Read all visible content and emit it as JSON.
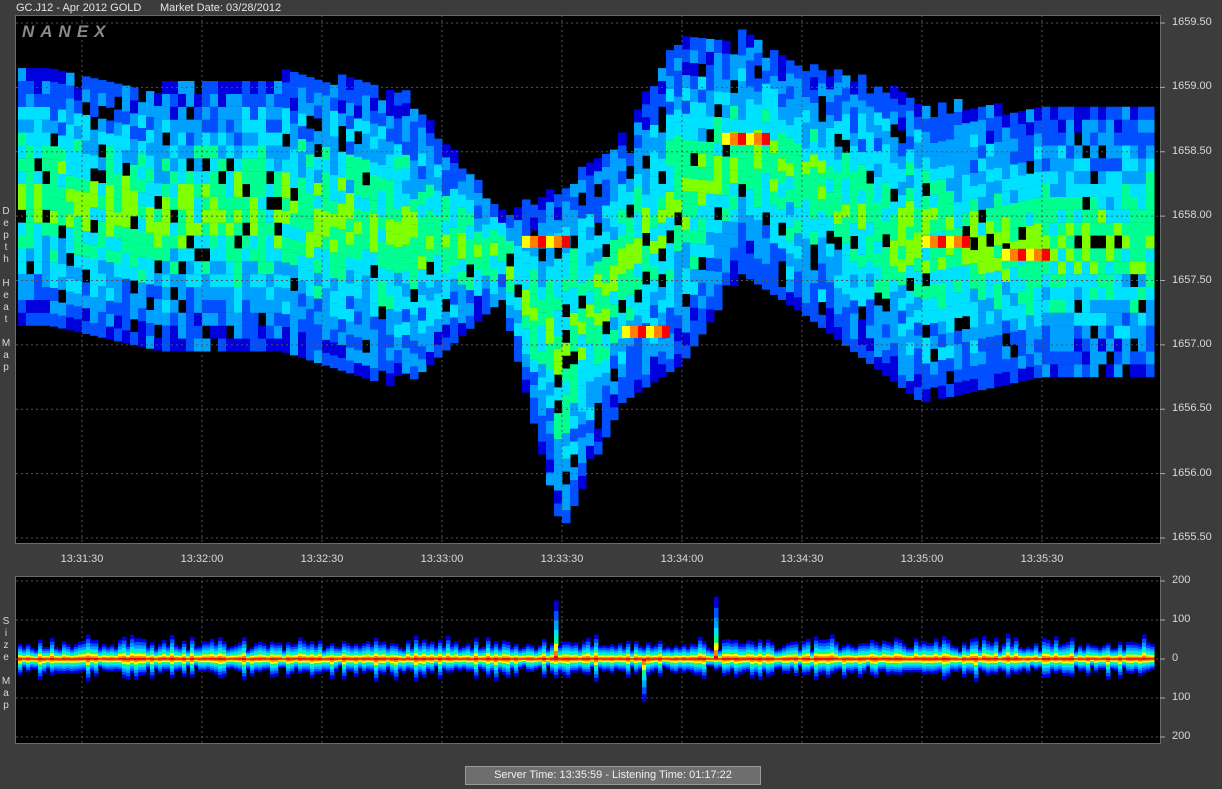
{
  "header": {
    "symbol": "GC.J12 - Apr 2012 GOLD",
    "market_date": "Market Date: 03/28/2012"
  },
  "logo": "NANEX",
  "status": {
    "text": "Server Time: 13:35:59  -  Listening Time: 01:17:22"
  },
  "side_labels": {
    "heat": [
      "D",
      "e",
      "p",
      "t",
      "h",
      " ",
      "H",
      "e",
      "a",
      "t",
      " ",
      "M",
      "a",
      "p"
    ],
    "size": [
      "S",
      "i",
      "z",
      "e",
      " ",
      "M",
      "a",
      "p"
    ]
  },
  "chart_data": [
    {
      "type": "heatmap",
      "title": "Depth Heat Map",
      "x_ticks": [
        "13:31:30",
        "13:32:00",
        "13:32:30",
        "13:33:00",
        "13:33:30",
        "13:34:00",
        "13:34:30",
        "13:35:00",
        "13:35:30"
      ],
      "y_ticks": [
        "1659.50",
        "1659.00",
        "1658.50",
        "1658.00",
        "1657.50",
        "1657.00",
        "1656.50",
        "1656.00",
        "1655.50"
      ],
      "ylim": [
        1655.5,
        1659.5
      ],
      "price_path": [
        {
          "t": "13:31:22",
          "low": 1657.2,
          "high": 1659.1
        },
        {
          "t": "13:31:50",
          "low": 1657.0,
          "high": 1659.0
        },
        {
          "t": "13:32:20",
          "low": 1657.0,
          "high": 1659.1
        },
        {
          "t": "13:32:50",
          "low": 1656.7,
          "high": 1659.0
        },
        {
          "t": "13:33:15",
          "low": 1657.4,
          "high": 1658.0
        },
        {
          "t": "13:33:30",
          "low": 1655.6,
          "high": 1658.2
        },
        {
          "t": "13:33:45",
          "low": 1656.6,
          "high": 1658.6
        },
        {
          "t": "13:34:00",
          "low": 1656.9,
          "high": 1659.4
        },
        {
          "t": "13:34:15",
          "low": 1657.6,
          "high": 1659.4
        },
        {
          "t": "13:34:30",
          "low": 1657.3,
          "high": 1659.2
        },
        {
          "t": "13:35:00",
          "low": 1656.6,
          "high": 1658.9
        },
        {
          "t": "13:35:30",
          "low": 1656.8,
          "high": 1658.8
        }
      ],
      "hot_levels": [
        {
          "t": "13:33:25",
          "price": 1657.8
        },
        {
          "t": "13:33:50",
          "price": 1657.1
        },
        {
          "t": "13:34:15",
          "price": 1658.6
        },
        {
          "t": "13:35:05",
          "price": 1657.8
        },
        {
          "t": "13:35:25",
          "price": 1657.7
        }
      ],
      "colors": {
        "scale": [
          "#0000dd",
          "#0050ff",
          "#00a0ff",
          "#00e0ff",
          "#00ff90",
          "#80ff00",
          "#ffff00",
          "#ff8000",
          "#ff0000"
        ]
      }
    },
    {
      "type": "area",
      "title": "Size Map",
      "y_ticks": [
        "200",
        "100",
        "0",
        "100",
        "200"
      ],
      "ylim": [
        -200,
        200
      ],
      "spikes": [
        {
          "t": "13:33:28",
          "value": 150
        },
        {
          "t": "13:34:08",
          "value": 160
        },
        {
          "t": "13:33:50",
          "value": -110
        }
      ]
    }
  ]
}
